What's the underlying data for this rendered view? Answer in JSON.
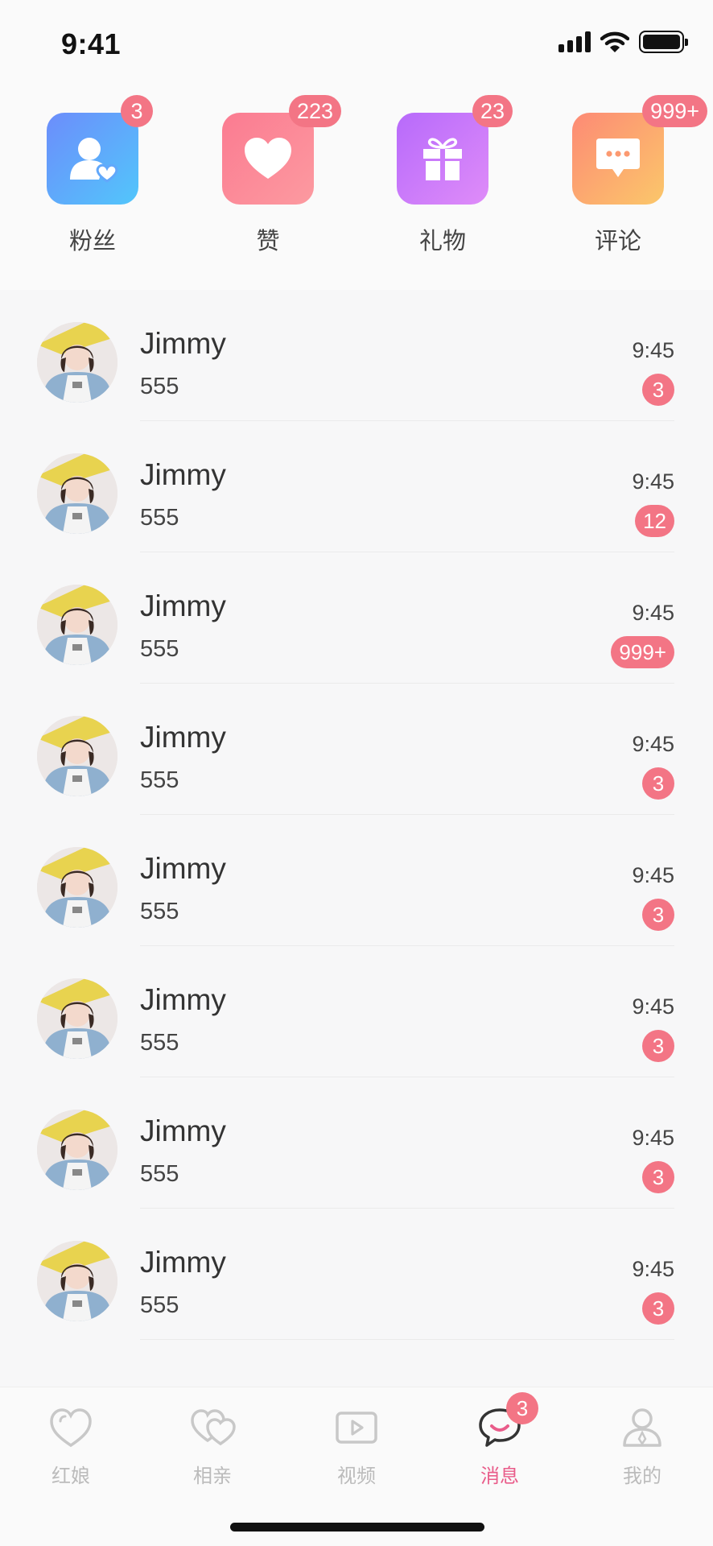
{
  "status_bar": {
    "time": "9:41"
  },
  "categories": [
    {
      "label": "粉丝",
      "badge": "3",
      "icon": "fans-icon",
      "gradient": [
        "#6c8dfb",
        "#52c6fb"
      ]
    },
    {
      "label": "赞",
      "badge": "223",
      "icon": "heart-icon",
      "gradient": [
        "#fb7b91",
        "#fc9aa0"
      ]
    },
    {
      "label": "礼物",
      "badge": "23",
      "icon": "gift-icon",
      "gradient": [
        "#b76afa",
        "#df8cf9"
      ]
    },
    {
      "label": "评论",
      "badge": "999+",
      "icon": "comment-icon",
      "gradient": [
        "#fd8a75",
        "#fbc76a"
      ]
    }
  ],
  "messages": [
    {
      "name": "Jimmy",
      "preview": "555",
      "time": "9:45",
      "unread": "3"
    },
    {
      "name": "Jimmy",
      "preview": "555",
      "time": "9:45",
      "unread": "12"
    },
    {
      "name": "Jimmy",
      "preview": "555",
      "time": "9:45",
      "unread": "999+"
    },
    {
      "name": "Jimmy",
      "preview": "555",
      "time": "9:45",
      "unread": "3"
    },
    {
      "name": "Jimmy",
      "preview": "555",
      "time": "9:45",
      "unread": "3"
    },
    {
      "name": "Jimmy",
      "preview": "555",
      "time": "9:45",
      "unread": "3"
    },
    {
      "name": "Jimmy",
      "preview": "555",
      "time": "9:45",
      "unread": "3"
    },
    {
      "name": "Jimmy",
      "preview": "555",
      "time": "9:45",
      "unread": "3"
    }
  ],
  "tabs": [
    {
      "label": "红娘",
      "icon": "matchmaker-heart-icon"
    },
    {
      "label": "相亲",
      "icon": "double-heart-icon"
    },
    {
      "label": "视频",
      "icon": "video-play-icon"
    },
    {
      "label": "消息",
      "icon": "chat-bubble-icon",
      "active": true,
      "badge": "3"
    },
    {
      "label": "我的",
      "icon": "profile-icon"
    }
  ],
  "colors": {
    "accent": "#e95c8a",
    "badge": "#f37585"
  }
}
